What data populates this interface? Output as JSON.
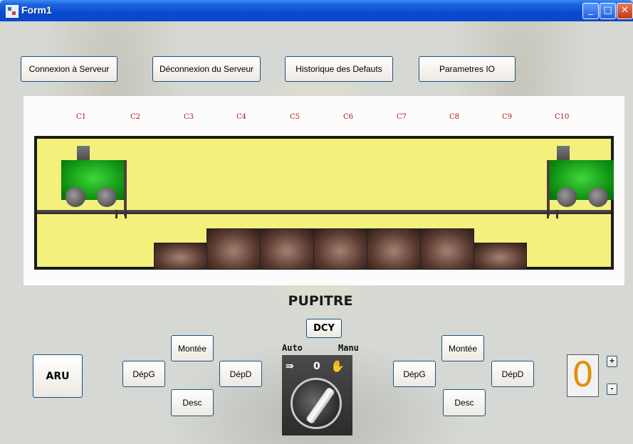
{
  "window": {
    "title": "Form1",
    "min_glyph": "_",
    "max_glyph": "□",
    "close_glyph": "✕"
  },
  "toolbar": {
    "connect": "Connexion à Serveur",
    "disconnect": "Déconnexion du Serveur",
    "fault_history": "Historique des Defauts",
    "io_params": "Parametres IO"
  },
  "track": {
    "columns": [
      "C1",
      "C2",
      "C3",
      "C4",
      "C5",
      "C6",
      "C7",
      "C8",
      "C9",
      "C10"
    ],
    "colors": {
      "yard": "#f4f07c",
      "wagon": "#1bb11b",
      "label": "#b01818"
    }
  },
  "console": {
    "title": "PUPITRE",
    "dcy": "DCY",
    "aru": "ARU",
    "auto_label": "Auto",
    "manu_label": "Manu",
    "switch_zero": "0",
    "left": {
      "up": "Montée",
      "left": "DépG",
      "right": "DépD",
      "down": "Desc"
    },
    "right": {
      "up": "Montée",
      "left": "DépG",
      "right": "DépD",
      "down": "Desc"
    },
    "counter_value": "0",
    "plus": "+",
    "minus": "-"
  }
}
